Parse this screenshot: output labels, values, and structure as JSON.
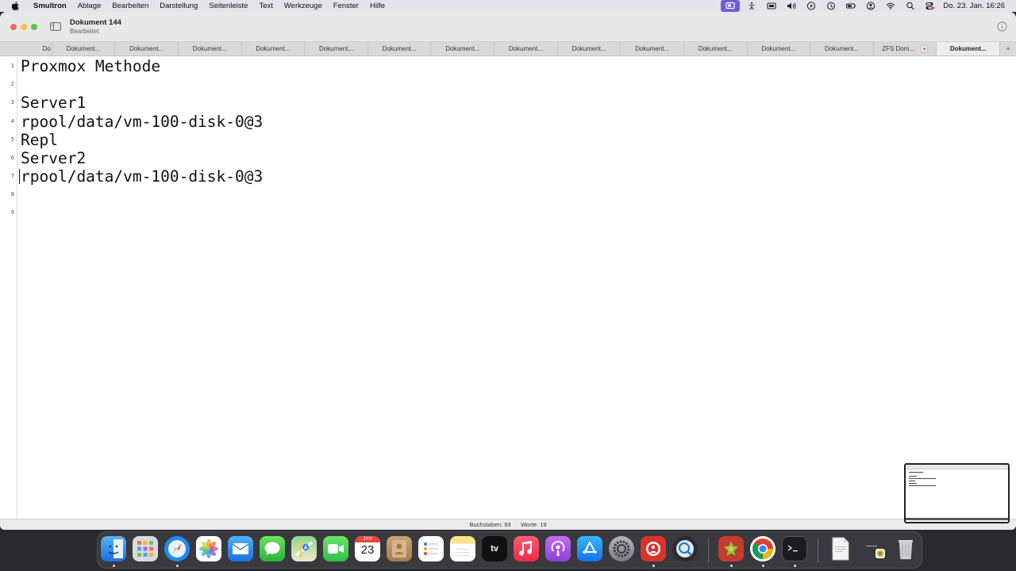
{
  "menubar": {
    "app_name": "Smultron",
    "items": [
      "Ablage",
      "Bearbeiten",
      "Darstellung",
      "Seitenleiste",
      "Text",
      "Werkzeuge",
      "Fenster",
      "Hilfe"
    ],
    "clock": "Do. 23. Jan.  16:26",
    "status_icons": [
      "screen-share-icon",
      "accessibility-icon",
      "window-icon",
      "volume-icon",
      "play-icon",
      "time-machine-icon",
      "battery-icon",
      "user-icon",
      "wifi-icon",
      "spotlight-icon",
      "control-center-icon"
    ]
  },
  "window": {
    "title": "Dokument 144",
    "subtitle": "Bearbeitet"
  },
  "tabs": [
    {
      "label": "Do"
    },
    {
      "label": "Dokument..."
    },
    {
      "label": "Dokument..."
    },
    {
      "label": "Dokument..."
    },
    {
      "label": "Dokument..."
    },
    {
      "label": "Dokument..."
    },
    {
      "label": "Dokument..."
    },
    {
      "label": "Dokument..."
    },
    {
      "label": "Dokument..."
    },
    {
      "label": "Dokument..."
    },
    {
      "label": "Dokument..."
    },
    {
      "label": "Dokument..."
    },
    {
      "label": "Dokument..."
    },
    {
      "label": "Dokument..."
    },
    {
      "label": "ZFS Dom..."
    },
    {
      "label": "Dokument..."
    }
  ],
  "tab_add": "+",
  "editor": {
    "line_numbers": [
      "1",
      "2",
      "3",
      "4",
      "5",
      "6",
      "7",
      "8",
      "9"
    ],
    "lines": [
      "Proxmox Methode",
      "",
      "Server1",
      "rpool/data/vm-100-disk-0@3",
      "Repl",
      "Server2",
      "rpool/data/vm-100-disk-0@3",
      "",
      ""
    ],
    "cursor_line": 7
  },
  "statusbar": {
    "chars": "Buchstaben: 93",
    "separator": "·",
    "words": "Worte: 19"
  },
  "dock": {
    "calendar_month": "JAN",
    "calendar_day": "23",
    "tv_label": "tv",
    "apps": [
      "finder-icon",
      "launchpad-icon",
      "safari-icon",
      "photos-icon",
      "mail-icon",
      "messages-icon",
      "maps-icon",
      "facetime-icon",
      "calendar-icon",
      "contacts-icon",
      "reminders-icon",
      "notes-icon",
      "apple-tv-icon",
      "music-icon",
      "podcasts-icon",
      "app-store-icon",
      "system-settings-icon",
      "app-red-icon",
      "app-search-icon",
      "app-star-icon",
      "chrome-icon",
      "terminal-icon",
      "document-icon",
      "downloads-icon",
      "trash-icon"
    ]
  },
  "colors": {
    "menubar_bg": "#e4e2ea",
    "accent_active": "#6e5ed6",
    "editor_text": "#111111"
  }
}
